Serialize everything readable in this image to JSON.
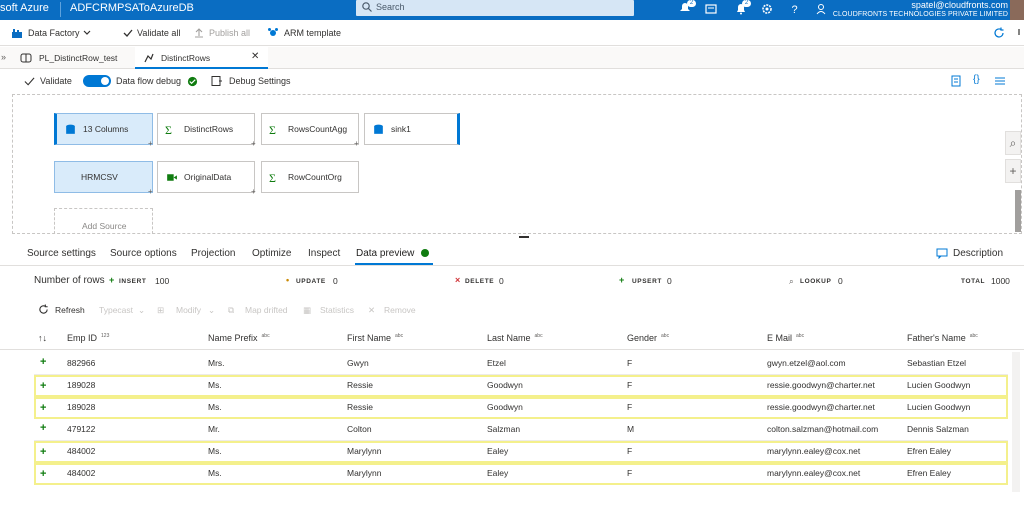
{
  "topbar": {
    "brand": "soft Azure",
    "factory_name": "ADFCRMPSAToAzureDB",
    "search_placeholder": "Search",
    "notif_count": "2",
    "feedback_count": "2",
    "user_email": "spatel@cloudfronts.com",
    "org": "CLOUDFRONTS TECHNOLOGIES PRIVATE LIMITED",
    "bar_color": "#0a6dc2"
  },
  "toolbar": {
    "data_factory": "Data Factory",
    "validate_all": "Validate all",
    "publish_all": "Publish all",
    "arm_template": "ARM template"
  },
  "tabs": [
    {
      "label": "PL_DistinctRow_test",
      "icon": "pipeline-icon"
    },
    {
      "label": "DistinctRows",
      "icon": "dataflow-icon",
      "active": true
    }
  ],
  "debug": {
    "validate": "Validate",
    "data_flow_debug": "Data flow debug",
    "debug_settings": "Debug Settings",
    "debug_on": true
  },
  "canvas": {
    "stream1": [
      {
        "label": "13 Columns",
        "icon": "source-icon"
      },
      {
        "label": "DistinctRows",
        "icon": "aggregate-icon"
      },
      {
        "label": "RowsCountAgg",
        "icon": "aggregate-icon"
      },
      {
        "label": "sink1",
        "icon": "sink-icon"
      }
    ],
    "stream2": [
      {
        "label": "HRMCSV",
        "icon": "source-icon"
      },
      {
        "label": "OriginalData",
        "icon": "derived-column-icon"
      },
      {
        "label": "RowCountOrg",
        "icon": "aggregate-icon"
      }
    ],
    "add_source": "Add Source"
  },
  "panel_tabs": [
    "Source settings",
    "Source options",
    "Projection",
    "Optimize",
    "Inspect",
    "Data preview"
  ],
  "description": "Description",
  "stats": {
    "number_of_rows": "Number of rows",
    "insert_label": "INSERT",
    "insert_value": "100",
    "update_label": "UPDATE",
    "update_value": "0",
    "delete_label": "DELETE",
    "delete_value": "0",
    "upsert_label": "UPSERT",
    "upsert_value": "0",
    "lookup_label": "LOOKUP",
    "lookup_value": "0",
    "total_label": "TOTAL",
    "total_value": "1000"
  },
  "actions": {
    "refresh": "Refresh",
    "typecast": "Typecast",
    "modify": "Modify",
    "map_drifted": "Map drifted",
    "statistics": "Statistics",
    "remove": "Remove"
  },
  "table": {
    "sort_glyph": "↑↓",
    "columns": [
      {
        "label": "Emp ID",
        "type": "123"
      },
      {
        "label": "Name Prefix",
        "type": "abc"
      },
      {
        "label": "First Name",
        "type": "abc"
      },
      {
        "label": "Last Name",
        "type": "abc"
      },
      {
        "label": "Gender",
        "type": "abc"
      },
      {
        "label": "E Mail",
        "type": "abc"
      },
      {
        "label": "Father's Name",
        "type": "abc"
      }
    ],
    "rows": [
      [
        "882966",
        "Mrs.",
        "Gwyn",
        "Etzel",
        "F",
        "gwyn.etzel@aol.com",
        "Sebastian Etzel"
      ],
      [
        "189028",
        "Ms.",
        "Ressie",
        "Goodwyn",
        "F",
        "ressie.goodwyn@charter.net",
        "Lucien Goodwyn"
      ],
      [
        "189028",
        "Ms.",
        "Ressie",
        "Goodwyn",
        "F",
        "ressie.goodwyn@charter.net",
        "Lucien Goodwyn"
      ],
      [
        "479122",
        "Mr.",
        "Colton",
        "Salzman",
        "M",
        "colton.salzman@hotmail.com",
        "Dennis Salzman"
      ],
      [
        "484002",
        "Ms.",
        "Marylynn",
        "Ealey",
        "F",
        "marylynn.ealey@cox.net",
        "Efren Ealey"
      ],
      [
        "484002",
        "Ms.",
        "Marylynn",
        "Ealey",
        "F",
        "marylynn.ealey@cox.net",
        "Efren Ealey"
      ]
    ],
    "highlight_color": "#f4f08c",
    "insert_color": "#107c10"
  }
}
